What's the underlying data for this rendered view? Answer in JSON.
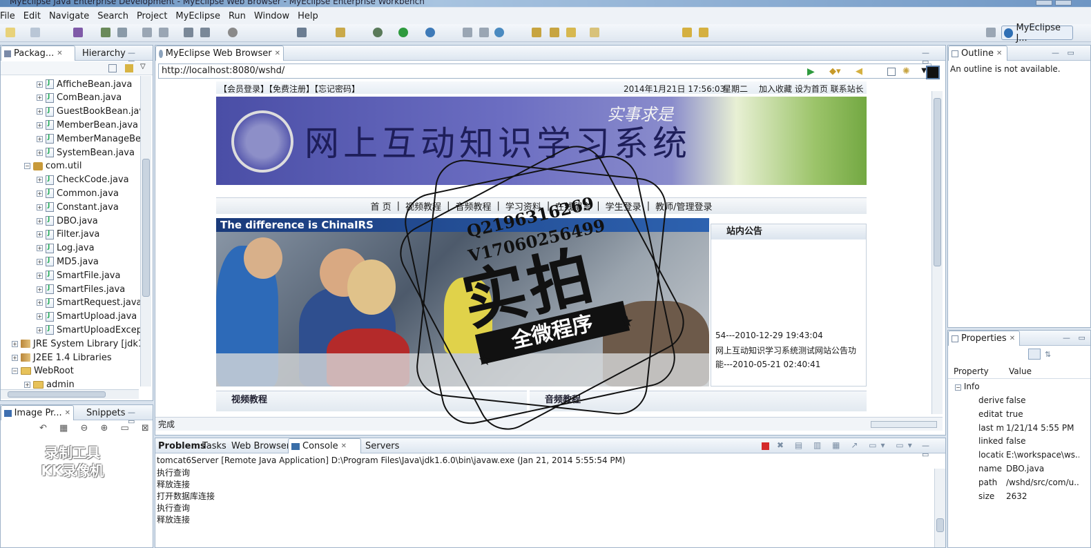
{
  "window": {
    "title": "MyEclipse Java Enterprise Development - MyEclipse Web Browser - MyEclipse Enterprise Workbench"
  },
  "menu": [
    "File",
    "Edit",
    "Navigate",
    "Search",
    "Project",
    "MyEclipse",
    "Run",
    "Window",
    "Help"
  ],
  "perspective": {
    "label": "MyEclipse J..."
  },
  "package_explorer": {
    "tabs": [
      "Packag...",
      "Hierarchy"
    ],
    "items": [
      {
        "label": "AfficheBean.java",
        "kind": "java-file"
      },
      {
        "label": "ComBean.java",
        "kind": "java-file"
      },
      {
        "label": "GuestBookBean.jav",
        "kind": "java-file"
      },
      {
        "label": "MemberBean.java",
        "kind": "java-file"
      },
      {
        "label": "MemberManageBe",
        "kind": "java-file"
      },
      {
        "label": "SystemBean.java",
        "kind": "java-file"
      },
      {
        "label": "com.util",
        "kind": "package"
      },
      {
        "label": "CheckCode.java",
        "kind": "java-file"
      },
      {
        "label": "Common.java",
        "kind": "java-file"
      },
      {
        "label": "Constant.java",
        "kind": "java-file"
      },
      {
        "label": "DBO.java",
        "kind": "java-file"
      },
      {
        "label": "Filter.java",
        "kind": "java-file"
      },
      {
        "label": "Log.java",
        "kind": "java-file"
      },
      {
        "label": "MD5.java",
        "kind": "java-file"
      },
      {
        "label": "SmartFile.java",
        "kind": "java-file"
      },
      {
        "label": "SmartFiles.java",
        "kind": "java-file"
      },
      {
        "label": "SmartRequest.java",
        "kind": "java-file"
      },
      {
        "label": "SmartUpload.java",
        "kind": "java-file"
      },
      {
        "label": "SmartUploadExcept",
        "kind": "java-file"
      },
      {
        "label": "JRE System Library [jdk1.6",
        "kind": "library"
      },
      {
        "label": "J2EE 1.4 Libraries",
        "kind": "library"
      },
      {
        "label": "WebRoot",
        "kind": "folder"
      },
      {
        "label": "admin",
        "kind": "folder"
      }
    ]
  },
  "image_preview": {
    "tabs": [
      "Image Pr...",
      "Snippets"
    ],
    "watermark_lines": [
      "录制工具",
      "KK录像机"
    ]
  },
  "browser": {
    "tab_label": "MyEclipse Web Browser",
    "url": "http://localhost:8080/wshd/",
    "status": "完成",
    "site": {
      "top_left": "【会员登录】【免费注册】【忘记密码】",
      "datetime": "2014年1月21日 17:56:03",
      "weekday": "星期二",
      "top_links": "加入收藏 设为首页 联系站长",
      "banner_title": "网上互动知识学习系统",
      "banner_motto": "实事求是",
      "nav": [
        "首 页",
        "|",
        "视频教程",
        "|",
        "音频教程",
        "|",
        "学习资料",
        "|",
        "在线留言",
        "|",
        "学生登录",
        "|",
        "教师/管理登录"
      ],
      "photo_caption": "The difference is ChinaIRS",
      "notice": {
        "heading": "站内公告",
        "items": [
          "54---2010-12-29 19:43:04",
          "网上互动知识学习系统测试网站公告功",
          "能---2010-05-21 02:40:41"
        ]
      },
      "sections": [
        "视频教程",
        "音频教程"
      ]
    }
  },
  "stamp": {
    "qq": "Q2196316269",
    "vx": "V17060256499",
    "big": "实拍",
    "band": "全微程序"
  },
  "bottom_panel": {
    "tabs": [
      "Problems",
      "Tasks",
      "Web Browser",
      "Console",
      "Servers"
    ],
    "console_title": "tomcat6Server [Remote Java Application] D:\\Program Files\\Java\\jdk1.6.0\\bin\\javaw.exe (Jan 21, 2014 5:55:54 PM)",
    "console_lines": [
      "执行查询",
      "释放连接",
      "打开数据库连接",
      "执行查询",
      "释放连接"
    ]
  },
  "outline": {
    "tab_label": "Outline",
    "message": "An outline is not available."
  },
  "properties": {
    "tab_label": "Properties",
    "col_property": "Property",
    "col_value": "Value",
    "group": "Info",
    "rows": [
      {
        "key": "derive",
        "value": "false"
      },
      {
        "key": "editat",
        "value": "true"
      },
      {
        "key": "last m",
        "value": "1/21/14 5:55 PM"
      },
      {
        "key": "linked",
        "value": "false"
      },
      {
        "key": "locatic",
        "value": "E:\\workspace\\ws..."
      },
      {
        "key": "name",
        "value": "DBO.java"
      },
      {
        "key": "path",
        "value": "/wshd/src/com/u..."
      },
      {
        "key": "size",
        "value": "2632"
      }
    ]
  },
  "colors": {
    "accent": "#2f6fb4",
    "banner": "#4a4ea6",
    "panel_border": "#9fb3c8"
  }
}
